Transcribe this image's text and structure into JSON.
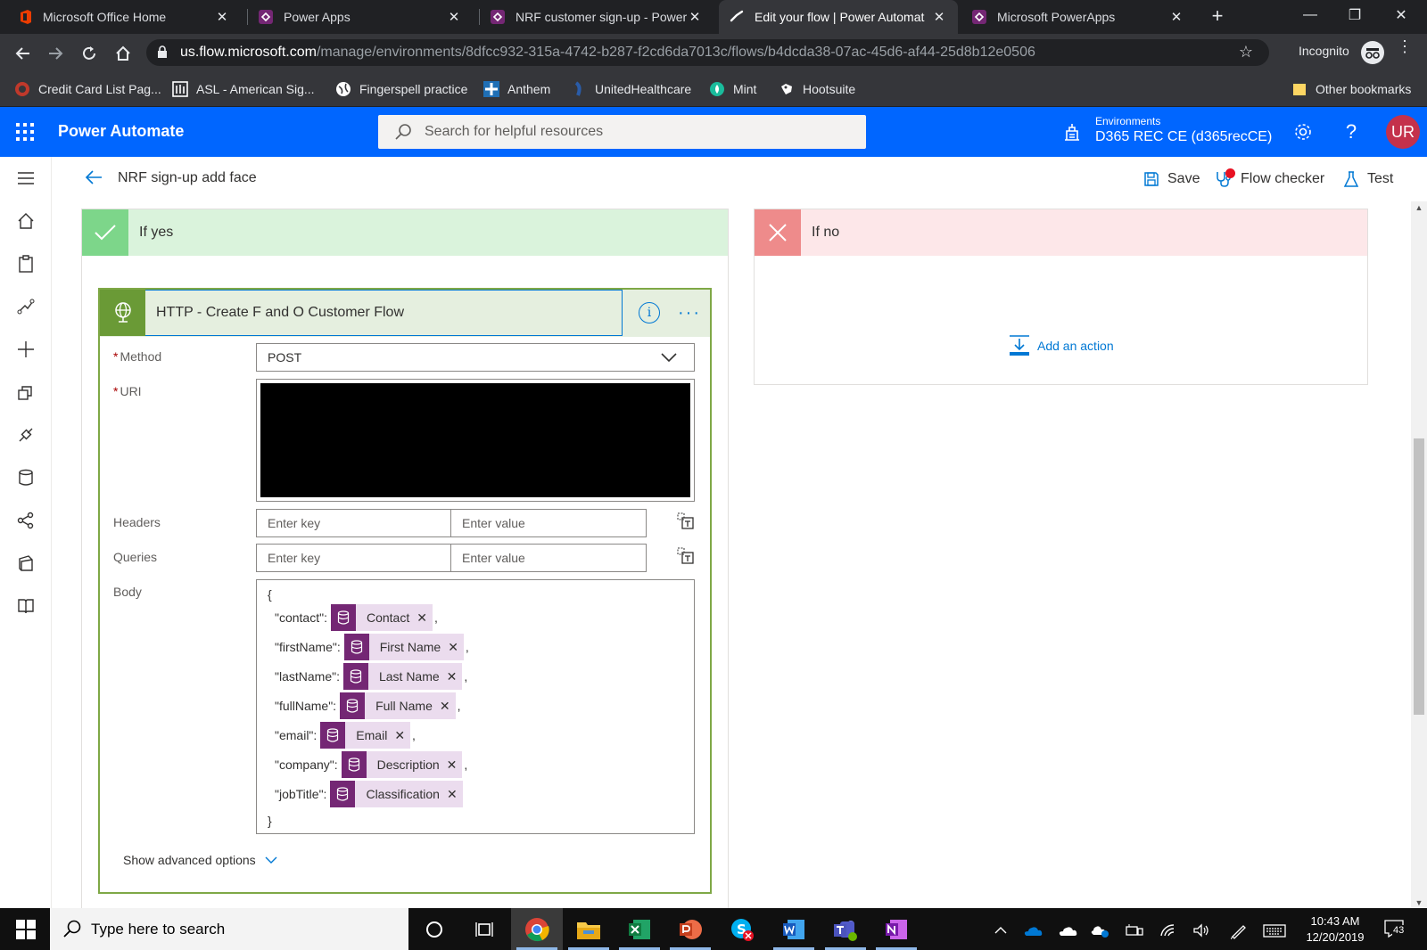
{
  "browser": {
    "tabs": [
      {
        "title": "Microsoft Office Home",
        "favicon": "office-icon",
        "color": "#eb3c00"
      },
      {
        "title": "Power Apps",
        "favicon": "powerapps-icon",
        "color": "#742774"
      },
      {
        "title": "NRF customer sign-up - Power",
        "favicon": "powerapps-icon",
        "color": "#742774"
      },
      {
        "title": "Edit your flow | Power Automat",
        "favicon": "powerautomate-icon",
        "color": "#0066ff"
      },
      {
        "title": "Microsoft PowerApps",
        "favicon": "powerapps-icon",
        "color": "#742774"
      }
    ],
    "url_host": "us.flow.microsoft.com",
    "url_path": "/manage/environments/8dfcc932-315a-4742-b287-f2cd6da7013c/flows/b4dcda38-07ac-45d6-af44-25d8b12e0506",
    "incognito_label": "Incognito",
    "bookmarks": [
      {
        "label": "Credit Card List Pag...",
        "color": "#c0392b"
      },
      {
        "label": "ASL - American Sig...",
        "color": "#ffffff"
      },
      {
        "label": "Fingerspell practice",
        "color": "#ffffff"
      },
      {
        "label": "Anthem",
        "color": "#1f6fb5"
      },
      {
        "label": "UnitedHealthcare",
        "color": "#2a5ca8"
      },
      {
        "label": "Mint",
        "color": "#1abc9c"
      },
      {
        "label": "Hootsuite",
        "color": "#ffffff"
      }
    ],
    "other_bookmarks": "Other bookmarks"
  },
  "app": {
    "name": "Power Automate",
    "search_placeholder": "Search for helpful resources",
    "environment_label": "Environments",
    "environment_name": "D365 REC CE (d365recCE)",
    "avatar_initials": "UR",
    "accent": "#0066ff"
  },
  "commandbar": {
    "flow_name": "NRF sign-up add face",
    "save": "Save",
    "flow_checker": "Flow checker",
    "test": "Test"
  },
  "branch_yes": {
    "title": "If yes",
    "card": {
      "title": "HTTP - Create F and O Customer Flow",
      "method_label": "Method",
      "method_value": "POST",
      "uri_label": "URI",
      "headers_label": "Headers",
      "queries_label": "Queries",
      "key_placeholder": "Enter key",
      "value_placeholder": "Enter value",
      "body_label": "Body",
      "body_open": "{",
      "body_close": "}",
      "body_rows": [
        {
          "key": "\"contact\":",
          "token": "Contact"
        },
        {
          "key": "\"firstName\":",
          "token": "First Name"
        },
        {
          "key": "\"lastName\":",
          "token": "Last Name"
        },
        {
          "key": "\"fullName\":",
          "token": "Full Name"
        },
        {
          "key": "\"email\":",
          "token": "Email"
        },
        {
          "key": "\"company\":",
          "token": "Description"
        },
        {
          "key": "\"jobTitle\":",
          "token": "Classification"
        }
      ],
      "advanced": "Show advanced options"
    }
  },
  "branch_no": {
    "title": "If no",
    "add_action": "Add an action"
  },
  "taskbar": {
    "search_placeholder": "Type here to search",
    "time": "10:43 AM",
    "date": "12/20/2019",
    "notifications": "43"
  }
}
